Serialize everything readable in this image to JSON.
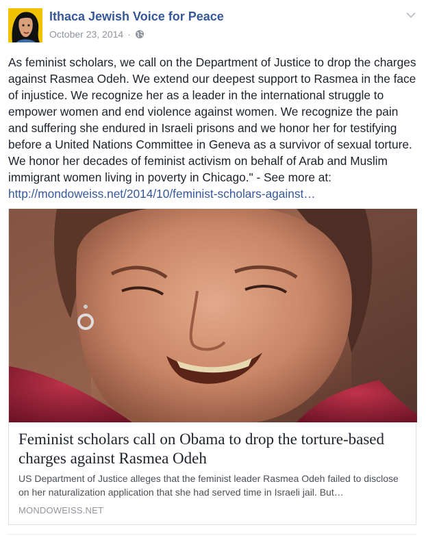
{
  "post": {
    "page_name": "Ithaca Jewish Voice for Peace",
    "date": "October 23, 2014",
    "separator": "·",
    "privacy_icon": "globe-icon",
    "menu_icon": "chevron-down-icon",
    "body_text": "As feminist scholars, we call on the Department of Justice to drop the charges against Rasmea Odeh. We extend our deepest support to Rasmea in the face of injustice. We recognize her as a leader in the international struggle to empower women and end violence against women. We recognize the pain and suffering she endured in Israeli prisons and we honor her for testifying before a United Nations Committee in Geneva as a survivor of sexual torture. We honor her decades of feminist activism on behalf of Arab and Muslim immigrant women living in poverty in Chicago.\" - See more at: ",
    "body_link": "http://mondoweiss.net/2014/10/feminist-scholars-against…"
  },
  "link_card": {
    "title": "Feminist scholars call on Obama to drop the torture-based charges against Rasmea Odeh",
    "description": "US Department of Justice alleges that the feminist leader Rasmea Odeh failed to disclose on her naturalization application that she had served time in Israeli jail. But…",
    "domain": "MONDOWEISS.NET"
  },
  "colors": {
    "link": "#365899",
    "text": "#1d2129",
    "meta": "#90949c",
    "border": "#dddfe2"
  }
}
